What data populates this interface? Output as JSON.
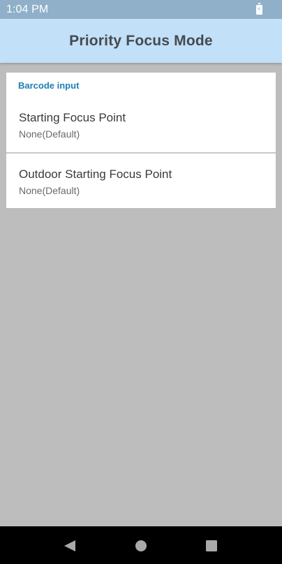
{
  "status_bar": {
    "time": "1:04 PM",
    "battery_icon": "battery-charging-icon"
  },
  "app_bar": {
    "title": "Priority Focus Mode"
  },
  "settings": {
    "section_header": "Barcode input",
    "items": [
      {
        "title": "Starting Focus Point",
        "summary": "None(Default)"
      },
      {
        "title": "Outdoor Starting Focus Point",
        "summary": "None(Default)"
      }
    ]
  },
  "nav_bar": {
    "back_icon": "back-triangle-icon",
    "home_icon": "home-circle-icon",
    "recents_icon": "recents-square-icon"
  },
  "colors": {
    "status_bar_bg": "#8fb0c8",
    "app_bar_bg": "#c2e0f7",
    "accent": "#1d7fb3",
    "background": "#bdbdbd"
  }
}
